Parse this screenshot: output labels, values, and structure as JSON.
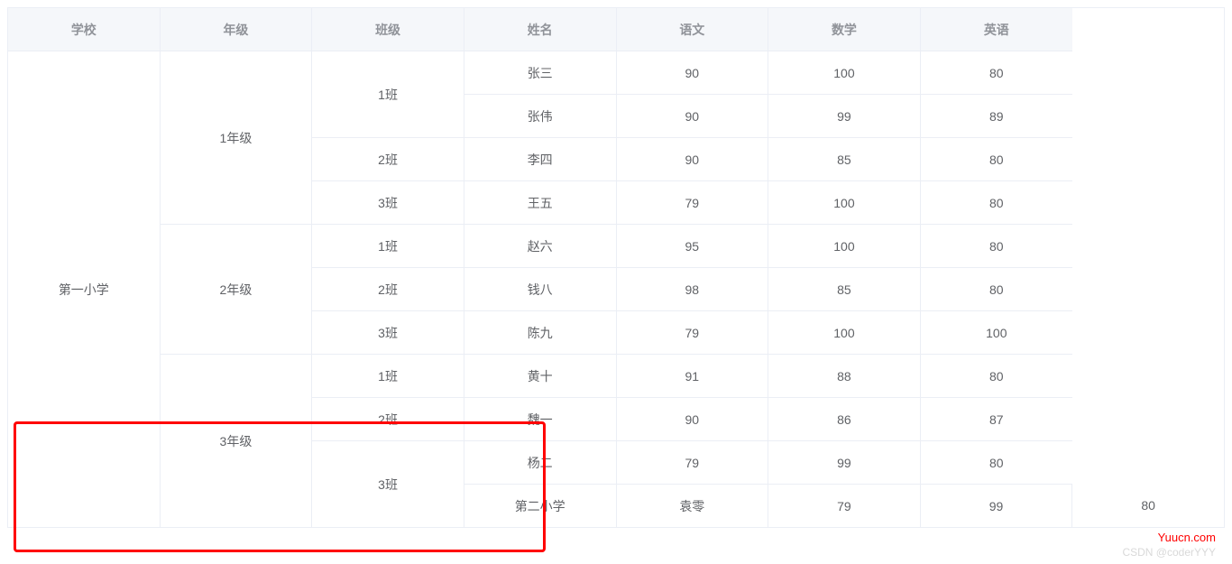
{
  "headers": [
    "学校",
    "年级",
    "班级",
    "姓名",
    "语文",
    "数学",
    "英语"
  ],
  "rows": [
    {
      "school": "第一小学",
      "schoolRowspan": 11,
      "grade": "1年级",
      "gradeRowspan": 4,
      "class": "1班",
      "classRowspan": 2,
      "name": "张三",
      "chinese": 90,
      "math": 100,
      "english": 80
    },
    {
      "name": "张伟",
      "chinese": 90,
      "math": 99,
      "english": 89
    },
    {
      "class": "2班",
      "classRowspan": 1,
      "name": "李四",
      "chinese": 90,
      "math": 85,
      "english": 80
    },
    {
      "class": "3班",
      "classRowspan": 1,
      "name": "王五",
      "chinese": 79,
      "math": 100,
      "english": 80
    },
    {
      "grade": "2年级",
      "gradeRowspan": 3,
      "class": "1班",
      "classRowspan": 1,
      "name": "赵六",
      "chinese": 95,
      "math": 100,
      "english": 80
    },
    {
      "class": "2班",
      "classRowspan": 1,
      "name": "钱八",
      "chinese": 98,
      "math": 85,
      "english": 80
    },
    {
      "class": "3班",
      "classRowspan": 1,
      "name": "陈九",
      "chinese": 79,
      "math": 100,
      "english": 100
    },
    {
      "grade": "3年级",
      "gradeRowspan": 4,
      "class": "1班",
      "classRowspan": 1,
      "name": "黄十",
      "chinese": 91,
      "math": 88,
      "english": 80
    },
    {
      "class": "2班",
      "classRowspan": 1,
      "name": "魏一",
      "chinese": 90,
      "math": 86,
      "english": 87
    },
    {
      "class": "3班",
      "classRowspan": 2,
      "name": "杨二",
      "chinese": 79,
      "math": 99,
      "english": 80
    },
    {
      "school": "第二小学",
      "schoolRowspan": 1,
      "name": "袁零",
      "chinese": 79,
      "math": 99,
      "english": 80
    }
  ],
  "watermarks": {
    "site": "Yuucn.com",
    "author": "CSDN @coderYYY"
  }
}
